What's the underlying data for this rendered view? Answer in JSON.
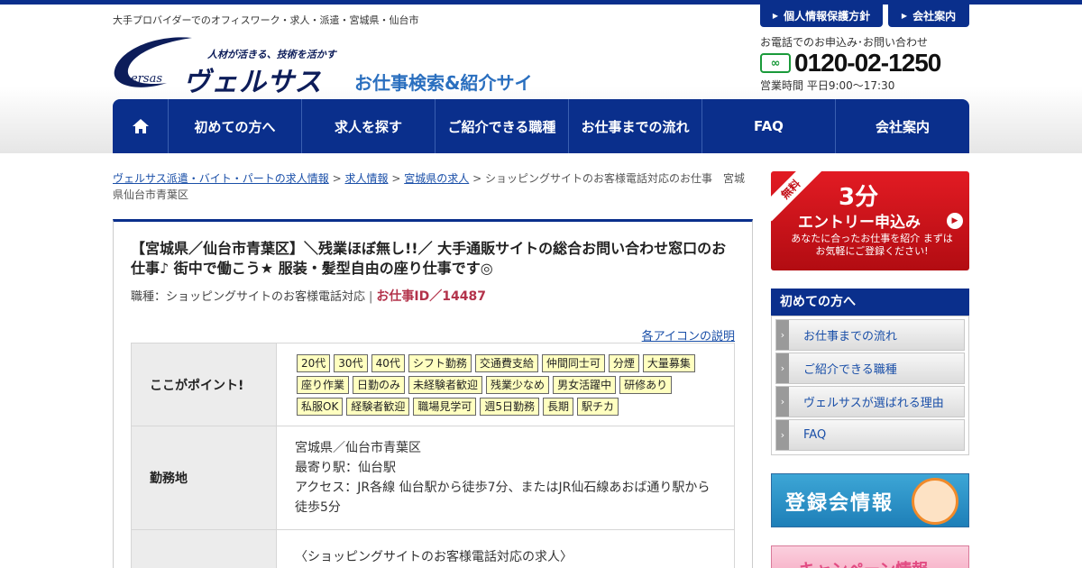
{
  "header": {
    "tagline": "大手プロバイダーでのオフィスワーク・求人・派遣・宮城県・仙台市",
    "logo_sub": "人材が活きる、技術を活かす",
    "logo_main": "ヴェルサス",
    "logo_versas": "ersas",
    "site_name": "お仕事検索&紹介サイト",
    "top_links": [
      "個人情報保護方針",
      "会社案内"
    ],
    "phone_label": "お電話でのお申込み･お問い合わせ",
    "freedial_mark": "∞",
    "phone": "0120-02-1250",
    "hours": "営業時間  平日9:00〜17:30"
  },
  "nav": {
    "items": [
      "初めての方へ",
      "求人を探す",
      "ご紹介できる職種",
      "お仕事までの流れ",
      "FAQ",
      "会社案内"
    ]
  },
  "breadcrumb": {
    "links": [
      "ヴェルサス派遣・バイト・パートの求人情報",
      "求人情報",
      "宮城県の求人"
    ],
    "current": "ショッピングサイトのお客様電話対応のお仕事　宮城県仙台市青葉区",
    "separator": ">"
  },
  "job": {
    "title": "【宮城県／仙台市青葉区】＼残業ほぼ無し!!／ 大手通販サイトの総合お問い合わせ窓口のお仕事♪ 街中で働こう★ 服装・髪型自由の座り仕事です◎",
    "job_type": "職種：ショッピングサイトのお客様電話対応",
    "job_id": "お仕事ID／14487",
    "icon_help": "各アイコンの説明",
    "points_label": "ここがポイント!",
    "tags": [
      "20代",
      "30代",
      "40代",
      "シフト勤務",
      "交通費支給",
      "仲間同士可",
      "分煙",
      "大量募集",
      "座り作業",
      "日勤のみ",
      "未経験者歓迎",
      "残業少なめ",
      "男女活躍中",
      "研修あり",
      "私服OK",
      "経験者歓迎",
      "職場見学可",
      "週5日勤務",
      "長期",
      "駅チカ"
    ],
    "location_label": "勤務地",
    "location_lines": [
      "宮城県／仙台市青葉区",
      "最寄り駅：仙台駅",
      "アクセス：JR各線 仙台駅から徒歩7分、またはJR仙石線あおば通り駅から徒歩5分"
    ],
    "desc_first_line": "〈ショッピングサイトのお客様電話対応の求人〉"
  },
  "sidebar": {
    "entry_ribbon": "無料",
    "entry_big": "3分",
    "entry_mid": "エントリー申込み",
    "entry_small": "あなたに合ったお仕事を紹介 まずはお気軽にご登録ください!",
    "menu_head": "初めての方へ",
    "menu_items": [
      "お仕事までの流れ",
      "ご紹介できる職種",
      "ヴェルサスが選ばれる理由",
      "FAQ"
    ],
    "banner1": "登録会情報",
    "banner2": "キャンペーン情報"
  },
  "colors": {
    "brand_navy": "#0a2f8c",
    "entry_red": "#d0141c",
    "tag_yellow": "#ffffc0",
    "job_id_red": "#b3324a"
  }
}
